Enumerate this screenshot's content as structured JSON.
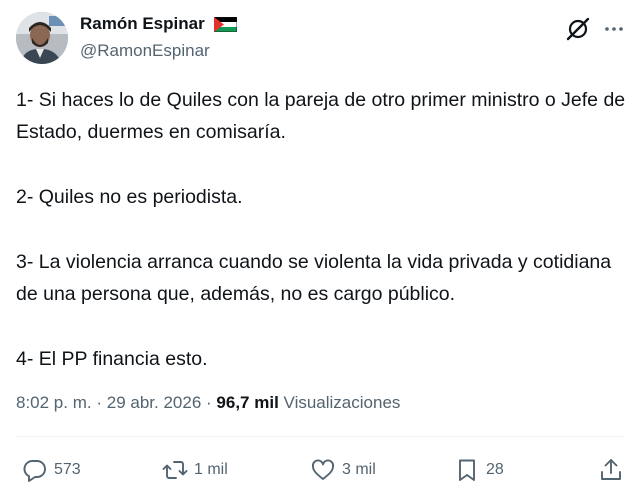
{
  "author": {
    "display_name": "Ramón Espinar",
    "handle": "@RamonEspinar"
  },
  "tweet": {
    "paragraphs": [
      "1- Si haces lo de Quiles con la pareja de otro primer ministro o Jefe de Estado, duermes en comisaría.",
      "2- Quiles no es periodista.",
      "3- La violencia arranca cuando se violenta la vida privada y cotidiana de una persona que, además, no es cargo público.",
      "4- El PP financia esto."
    ],
    "time": "8:02 p. m.",
    "separator": "·",
    "date": "29 abr. 2026",
    "views_count": "96,7 mil",
    "views_label": "Visualizaciones"
  },
  "actions": {
    "replies": "573",
    "reposts": "1 mil",
    "likes": "3 mil",
    "bookmarks": "28"
  },
  "icons": {
    "header": [
      "grok-icon",
      "more-icon"
    ],
    "actions": [
      "reply-icon",
      "repost-icon",
      "like-icon",
      "bookmark-icon",
      "share-icon"
    ]
  },
  "colors": {
    "text": "#0f1419",
    "secondary": "#536471",
    "divider": "#eff3f4",
    "flag_green": "#149954",
    "flag_red": "#e4312b"
  }
}
